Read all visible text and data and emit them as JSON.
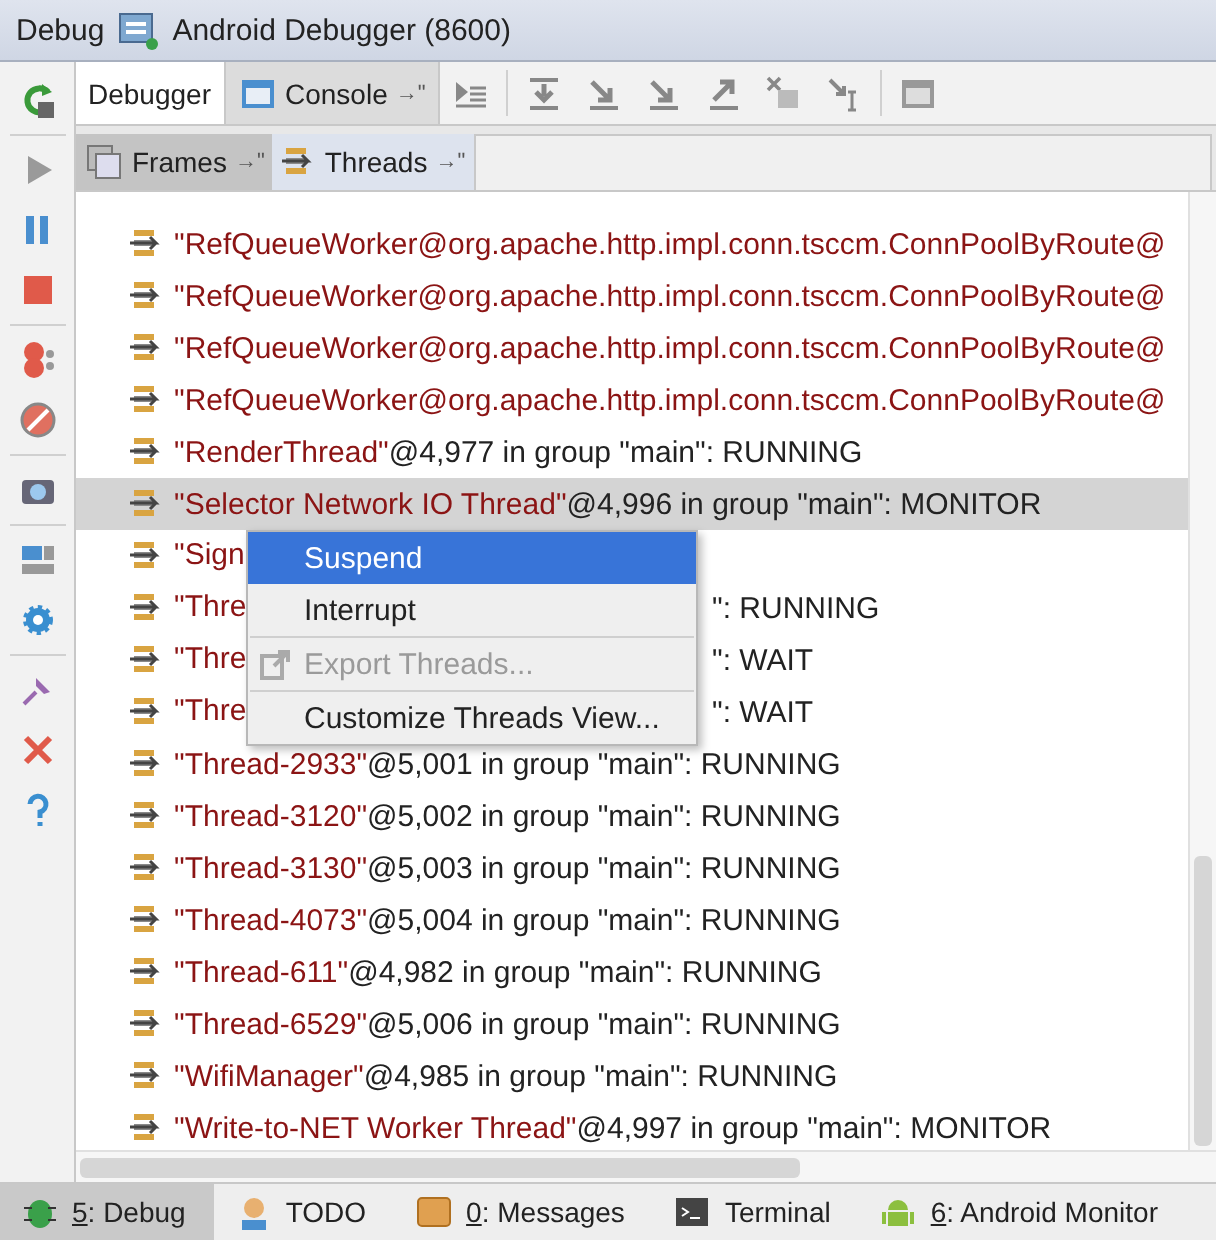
{
  "title_bar": {
    "label": "Debug",
    "session": "Android Debugger (8600)"
  },
  "tabs": [
    {
      "label": "Debugger",
      "selected": true,
      "kind": "plain"
    },
    {
      "label": "Console",
      "selected": false,
      "kind": "console"
    }
  ],
  "pin_mark": "→\"",
  "sub_tabs": [
    {
      "label": "Frames",
      "selected": false,
      "kind": "frames"
    },
    {
      "label": "Threads",
      "selected": true,
      "kind": "threads"
    }
  ],
  "threads": [
    {
      "kind": "full",
      "name": "\"RefQueueWorker@org.apache.http.impl.conn.tsccm.ConnPoolByRoute@",
      "selected": false
    },
    {
      "kind": "full",
      "name": "\"RefQueueWorker@org.apache.http.impl.conn.tsccm.ConnPoolByRoute@",
      "selected": false
    },
    {
      "kind": "full",
      "name": "\"RefQueueWorker@org.apache.http.impl.conn.tsccm.ConnPoolByRoute@",
      "selected": false
    },
    {
      "kind": "full",
      "name": "\"RefQueueWorker@org.apache.http.impl.conn.tsccm.ConnPoolByRoute@",
      "selected": false
    },
    {
      "kind": "full",
      "name": "\"RenderThread\"",
      "rest": "@4,977 in group \"main\": RUNNING",
      "selected": false
    },
    {
      "kind": "full",
      "name": "\"Selector Network IO Thread\"",
      "rest": "@4,996 in group \"main\": MONITOR",
      "selected": true
    },
    {
      "kind": "covered",
      "name": "\"Sign",
      "selected": false
    },
    {
      "kind": "covered",
      "name": "\"Thre",
      "tail": "\": RUNNING",
      "selected": false
    },
    {
      "kind": "covered",
      "name": "\"Thre",
      "tail": "\": WAIT",
      "selected": false
    },
    {
      "kind": "covered",
      "name": "\"Thre",
      "tail": "\": WAIT",
      "selected": false
    },
    {
      "kind": "full",
      "name": "\"Thread-2933\"",
      "rest": "@5,001 in group \"main\": RUNNING",
      "selected": false
    },
    {
      "kind": "full",
      "name": "\"Thread-3120\"",
      "rest": "@5,002 in group \"main\": RUNNING",
      "selected": false
    },
    {
      "kind": "full",
      "name": "\"Thread-3130\"",
      "rest": "@5,003 in group \"main\": RUNNING",
      "selected": false
    },
    {
      "kind": "full",
      "name": "\"Thread-4073\"",
      "rest": "@5,004 in group \"main\": RUNNING",
      "selected": false
    },
    {
      "kind": "full",
      "name": "\"Thread-611\"",
      "rest": "@4,982 in group \"main\": RUNNING",
      "selected": false
    },
    {
      "kind": "full",
      "name": "\"Thread-6529\"",
      "rest": "@5,006 in group \"main\": RUNNING",
      "selected": false
    },
    {
      "kind": "full",
      "name": "\"WifiManager\"",
      "rest": "@4,985 in group \"main\": RUNNING",
      "selected": false
    },
    {
      "kind": "full",
      "name": "\"Write-to-NET Worker Thread\"",
      "rest": "@4,997 in group \"main\": MONITOR",
      "selected": false
    }
  ],
  "context_menu": [
    {
      "kind": "item",
      "label": "Suspend",
      "selected": true,
      "disabled": false
    },
    {
      "kind": "item",
      "label": "Interrupt",
      "selected": false,
      "disabled": false
    },
    {
      "kind": "separator"
    },
    {
      "kind": "export",
      "label": "Export Threads...",
      "selected": false,
      "disabled": true
    },
    {
      "kind": "separator"
    },
    {
      "kind": "item",
      "label": "Customize Threads View...",
      "selected": false,
      "disabled": false
    }
  ],
  "tool_windows": [
    {
      "kind": "debug",
      "mnemonic": "5",
      "label": ": Debug",
      "selected": true
    },
    {
      "kind": "todo",
      "label": "TODO",
      "selected": false
    },
    {
      "kind": "messages",
      "mnemonic": "0",
      "label": ": Messages",
      "selected": false
    },
    {
      "kind": "terminal",
      "label": "Terminal",
      "selected": false
    },
    {
      "kind": "android",
      "mnemonic": "6",
      "label": ": Android Monitor",
      "selected": false
    }
  ]
}
